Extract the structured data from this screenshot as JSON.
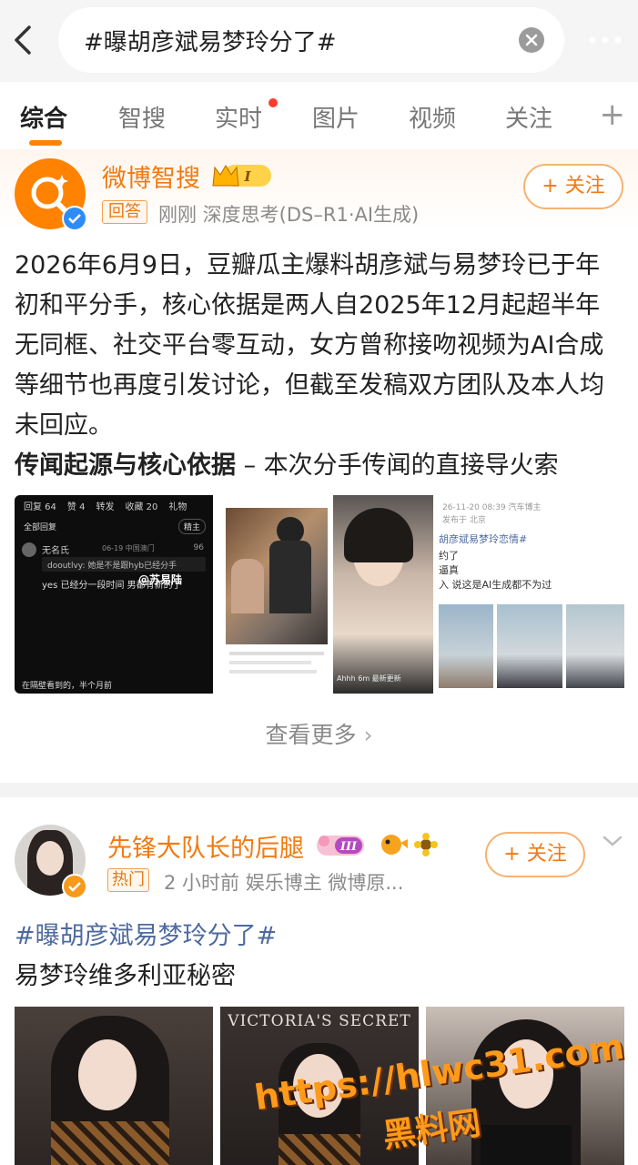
{
  "search": {
    "query": "#曝胡彦斌易梦玲分了#"
  },
  "tabs": [
    {
      "label": "综合"
    },
    {
      "label": "智搜"
    },
    {
      "label": "实时"
    },
    {
      "label": "图片"
    },
    {
      "label": "视频"
    },
    {
      "label": "关注"
    }
  ],
  "tabs_plus": "+",
  "post1": {
    "author": "微博智搜",
    "level_badge": "I",
    "tag": "回答",
    "meta": "刚刚  深度思考(DS–R1·AI生成)",
    "follow_label": "+ 关注",
    "paragraph": "2026年6月9日，豆瓣瓜主爆料胡彦斌与易梦玲已于年初和平分手，核心依据是两人自2025年12月起超半年无同框、社交平台零互动，女方曾称接吻视频为AI合成等细节也再度引发讨论，但截至发稿双方团队及本人均未回应。",
    "subheading": "传闻起源与核心依据",
    "subheading_tail": " – 本次分手传闻的直接导火索",
    "image1": {
      "tabs": [
        "回复 64",
        "赞 4",
        "转发",
        "收藏 20",
        "礼物"
      ],
      "sort_label": "全部回复",
      "sort_btn": "精主",
      "commenter": "无名氏",
      "comment_meta": "06-19  中国澳门",
      "comment_count": "96",
      "reply_user": "dooutlvy",
      "reply_text": "她是不是跟hyb已经分手",
      "reply2": "yes 已经分一段时间 男都有新的了",
      "watermark": "@苏易陆",
      "footer_text": "在隔壁看到的，半个月前"
    },
    "image3_caption": "Ahhh 6m 最新更新",
    "image4": {
      "header": "26-11-20 08:39  汽车博主",
      "location": "发布于 北京",
      "tag_line": "胡彦斌易梦玲恋情#",
      "line2": "约了",
      "line3": "逼真",
      "line4": "入  说这是AI生成都不为过"
    },
    "see_more": "查看更多"
  },
  "post2": {
    "author": "先锋大队长的后腿",
    "level_badge": "III",
    "tag": "热门",
    "meta": "2 小时前  娱乐博主 微博原...",
    "follow_label": "+ 关注",
    "hashtag": "#曝胡彦斌易梦玲分了#",
    "text": "易梦玲维多利亚秘密",
    "image_brand": "VICTORIA'S SECRET"
  },
  "watermark": {
    "url": "https://hlwc31.com",
    "name": "黑料网"
  },
  "colors": {
    "accent": "#ff8200",
    "author": "#f07a12",
    "hashtag": "#4d6a9e",
    "verified_blue": "#2f8cf5"
  }
}
